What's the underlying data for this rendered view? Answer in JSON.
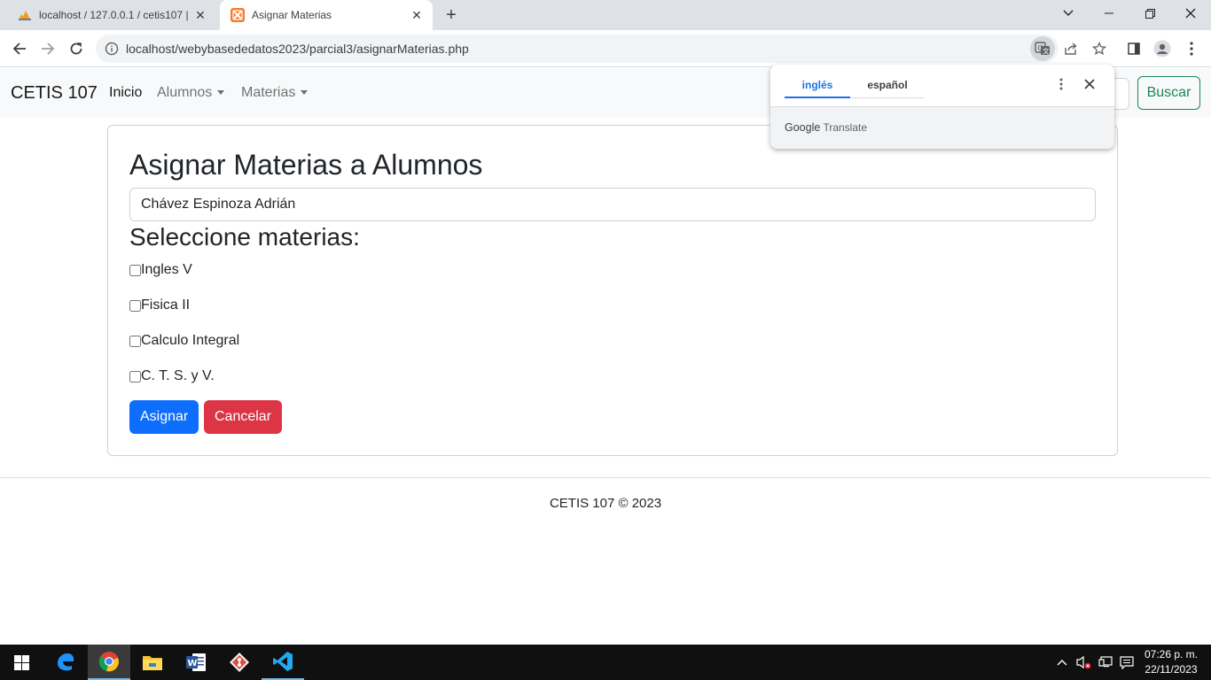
{
  "browser": {
    "tabs": [
      {
        "title": "localhost / 127.0.0.1 / cetis107 |",
        "active": false,
        "favicon": "phpmyadmin-icon"
      },
      {
        "title": "Asignar Materias",
        "active": true,
        "favicon": "xampp-icon"
      }
    ],
    "url": "localhost/webybasededatos2023/parcial3/asignarMaterias.php"
  },
  "navbar": {
    "brand": "CETIS 107",
    "links": [
      {
        "label": "Inicio",
        "active": true,
        "dropdown": false
      },
      {
        "label": "Alumnos",
        "active": false,
        "dropdown": true
      },
      {
        "label": "Materias",
        "active": false,
        "dropdown": true
      }
    ],
    "search_button": "Buscar"
  },
  "main": {
    "title": "Asignar Materias a Alumnos",
    "student_value": "Chávez Espinoza Adrián",
    "subjects_heading": "Seleccione materias:",
    "subjects": [
      {
        "label": "Ingles V",
        "checked": false
      },
      {
        "label": "Fisica II",
        "checked": false
      },
      {
        "label": "Calculo Integral",
        "checked": false
      },
      {
        "label": "C. T. S. y V.",
        "checked": false
      }
    ],
    "assign_button": "Asignar",
    "cancel_button": "Cancelar"
  },
  "footer": {
    "text": "CETIS 107 © 2023"
  },
  "translate_popup": {
    "tab_source": "inglés",
    "tab_target": "español",
    "brand_google": "Google",
    "brand_translate": "Translate"
  },
  "taskbar": {
    "apps": [
      "edge-icon",
      "chrome-icon",
      "file-explorer-icon",
      "word-icon",
      "git-icon",
      "vscode-icon"
    ],
    "time": "07:26 p. m.",
    "date": "22/11/2023"
  },
  "colors": {
    "primary": "#0d6efd",
    "danger": "#dc3545",
    "success": "#198754",
    "chrome_accent": "#1a73e8"
  }
}
